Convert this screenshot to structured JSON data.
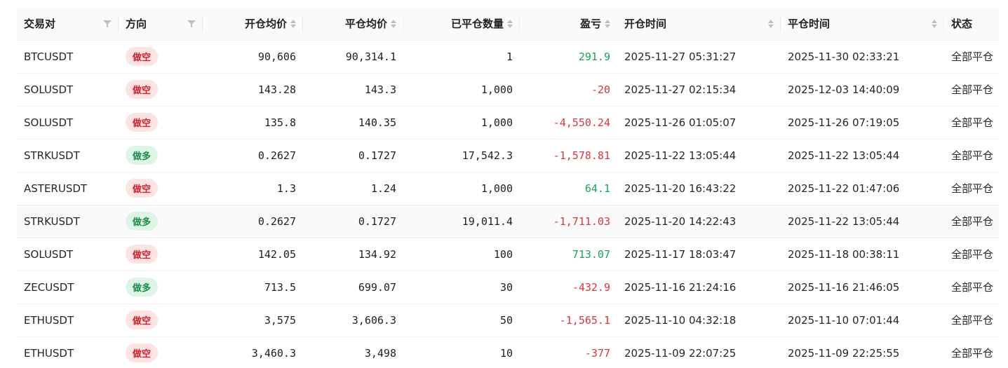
{
  "table": {
    "columns": {
      "symbol": "交易对",
      "side": "方向",
      "open_avg": "开仓均价",
      "close_avg": "平仓均价",
      "closed_qty": "已平仓数量",
      "pnl": "盈亏",
      "open_time": "开仓时间",
      "close_time": "平仓时间",
      "status": "状态"
    },
    "rows": [
      {
        "symbol": "BTCUSDT",
        "side": "做空",
        "side_type": "short",
        "open_avg": "90,606",
        "close_avg": "90,314.1",
        "closed_qty": "1",
        "pnl": "291.9",
        "pnl_sign": "pos",
        "open_time": "2025-11-27 05:31:27",
        "close_time": "2025-11-30 02:33:21",
        "status": "全部平仓"
      },
      {
        "symbol": "SOLUSDT",
        "side": "做空",
        "side_type": "short",
        "open_avg": "143.28",
        "close_avg": "143.3",
        "closed_qty": "1,000",
        "pnl": "-20",
        "pnl_sign": "neg",
        "open_time": "2025-11-27 02:15:34",
        "close_time": "2025-12-03 14:40:09",
        "status": "全部平仓"
      },
      {
        "symbol": "SOLUSDT",
        "side": "做空",
        "side_type": "short",
        "open_avg": "135.8",
        "close_avg": "140.35",
        "closed_qty": "1,000",
        "pnl": "-4,550.24",
        "pnl_sign": "neg",
        "open_time": "2025-11-26 01:05:07",
        "close_time": "2025-11-26 07:19:05",
        "status": "全部平仓"
      },
      {
        "symbol": "STRKUSDT",
        "side": "做多",
        "side_type": "long",
        "open_avg": "0.2627",
        "close_avg": "0.1727",
        "closed_qty": "17,542.3",
        "pnl": "-1,578.81",
        "pnl_sign": "neg",
        "open_time": "2025-11-22 13:05:44",
        "close_time": "2025-11-22 13:05:44",
        "status": "全部平仓"
      },
      {
        "symbol": "ASTERUSDT",
        "side": "做空",
        "side_type": "short",
        "open_avg": "1.3",
        "close_avg": "1.24",
        "closed_qty": "1,000",
        "pnl": "64.1",
        "pnl_sign": "pos",
        "open_time": "2025-11-20 16:43:22",
        "close_time": "2025-11-22 01:47:06",
        "status": "全部平仓"
      },
      {
        "symbol": "STRKUSDT",
        "side": "做多",
        "side_type": "long",
        "open_avg": "0.2627",
        "close_avg": "0.1727",
        "closed_qty": "19,011.4",
        "pnl": "-1,711.03",
        "pnl_sign": "neg",
        "open_time": "2025-11-20 14:22:43",
        "close_time": "2025-11-22 13:05:44",
        "status": "全部平仓"
      },
      {
        "symbol": "SOLUSDT",
        "side": "做空",
        "side_type": "short",
        "open_avg": "142.05",
        "close_avg": "134.92",
        "closed_qty": "100",
        "pnl": "713.07",
        "pnl_sign": "pos",
        "open_time": "2025-11-17 18:03:47",
        "close_time": "2025-11-18 00:38:11",
        "status": "全部平仓"
      },
      {
        "symbol": "ZECUSDT",
        "side": "做多",
        "side_type": "long",
        "open_avg": "713.5",
        "close_avg": "699.07",
        "closed_qty": "30",
        "pnl": "-432.9",
        "pnl_sign": "neg",
        "open_time": "2025-11-16 21:24:16",
        "close_time": "2025-11-16 21:46:05",
        "status": "全部平仓"
      },
      {
        "symbol": "ETHUSDT",
        "side": "做空",
        "side_type": "short",
        "open_avg": "3,575",
        "close_avg": "3,606.3",
        "closed_qty": "50",
        "pnl": "-1,565.1",
        "pnl_sign": "neg",
        "open_time": "2025-11-10 04:32:18",
        "close_time": "2025-11-10 07:01:44",
        "status": "全部平仓"
      },
      {
        "symbol": "ETHUSDT",
        "side": "做空",
        "side_type": "short",
        "open_avg": "3,460.3",
        "close_avg": "3,498",
        "closed_qty": "10",
        "pnl": "-377",
        "pnl_sign": "neg",
        "open_time": "2025-11-09 22:07:25",
        "close_time": "2025-11-09 22:25:55",
        "status": "全部平仓"
      }
    ]
  },
  "colors": {
    "pnl_positive": "#1ba35a",
    "pnl_negative": "#d9363e",
    "badge_short_bg": "#fde3e3",
    "badge_long_bg": "#ddf5e6"
  },
  "icons": {
    "filter": "filter-icon",
    "sort": "sort-icon"
  }
}
